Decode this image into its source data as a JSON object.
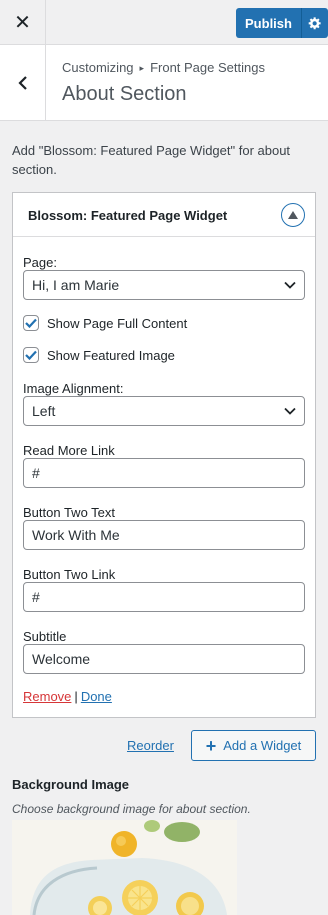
{
  "topbar": {
    "close_icon": "close-icon",
    "publish_label": "Publish",
    "settings_icon": "gear-icon"
  },
  "header": {
    "breadcrumb_root": "Customizing",
    "breadcrumb_parent": "Front Page Settings",
    "title": "About Section",
    "back_icon": "chevron-left-icon"
  },
  "description": "Add \"Blossom: Featured Page Widget\" for about section.",
  "widget": {
    "title": "Blossom: Featured Page Widget",
    "page_label": "Page:",
    "page_value": "Hi, I am Marie",
    "show_full_content_label": "Show Page Full Content",
    "show_full_content_checked": true,
    "show_featured_image_label": "Show Featured Image",
    "show_featured_image_checked": true,
    "image_alignment_label": "Image Alignment:",
    "image_alignment_value": "Left",
    "read_more_label": "Read More Link",
    "read_more_value": "#",
    "button_two_text_label": "Button Two Text",
    "button_two_text_value": "Work With Me",
    "button_two_link_label": "Button Two Link",
    "button_two_link_value": "#",
    "subtitle_label": "Subtitle",
    "subtitle_value": "Welcome",
    "remove_label": "Remove",
    "separator": "|",
    "done_label": "Done"
  },
  "footer": {
    "reorder_label": "Reorder",
    "add_widget_label": "Add a Widget"
  },
  "background": {
    "title": "Background Image",
    "description": "Choose background image for about section."
  },
  "colors": {
    "accent": "#2271b1",
    "danger": "#d63638",
    "panel_bg": "#f0f0f1"
  }
}
